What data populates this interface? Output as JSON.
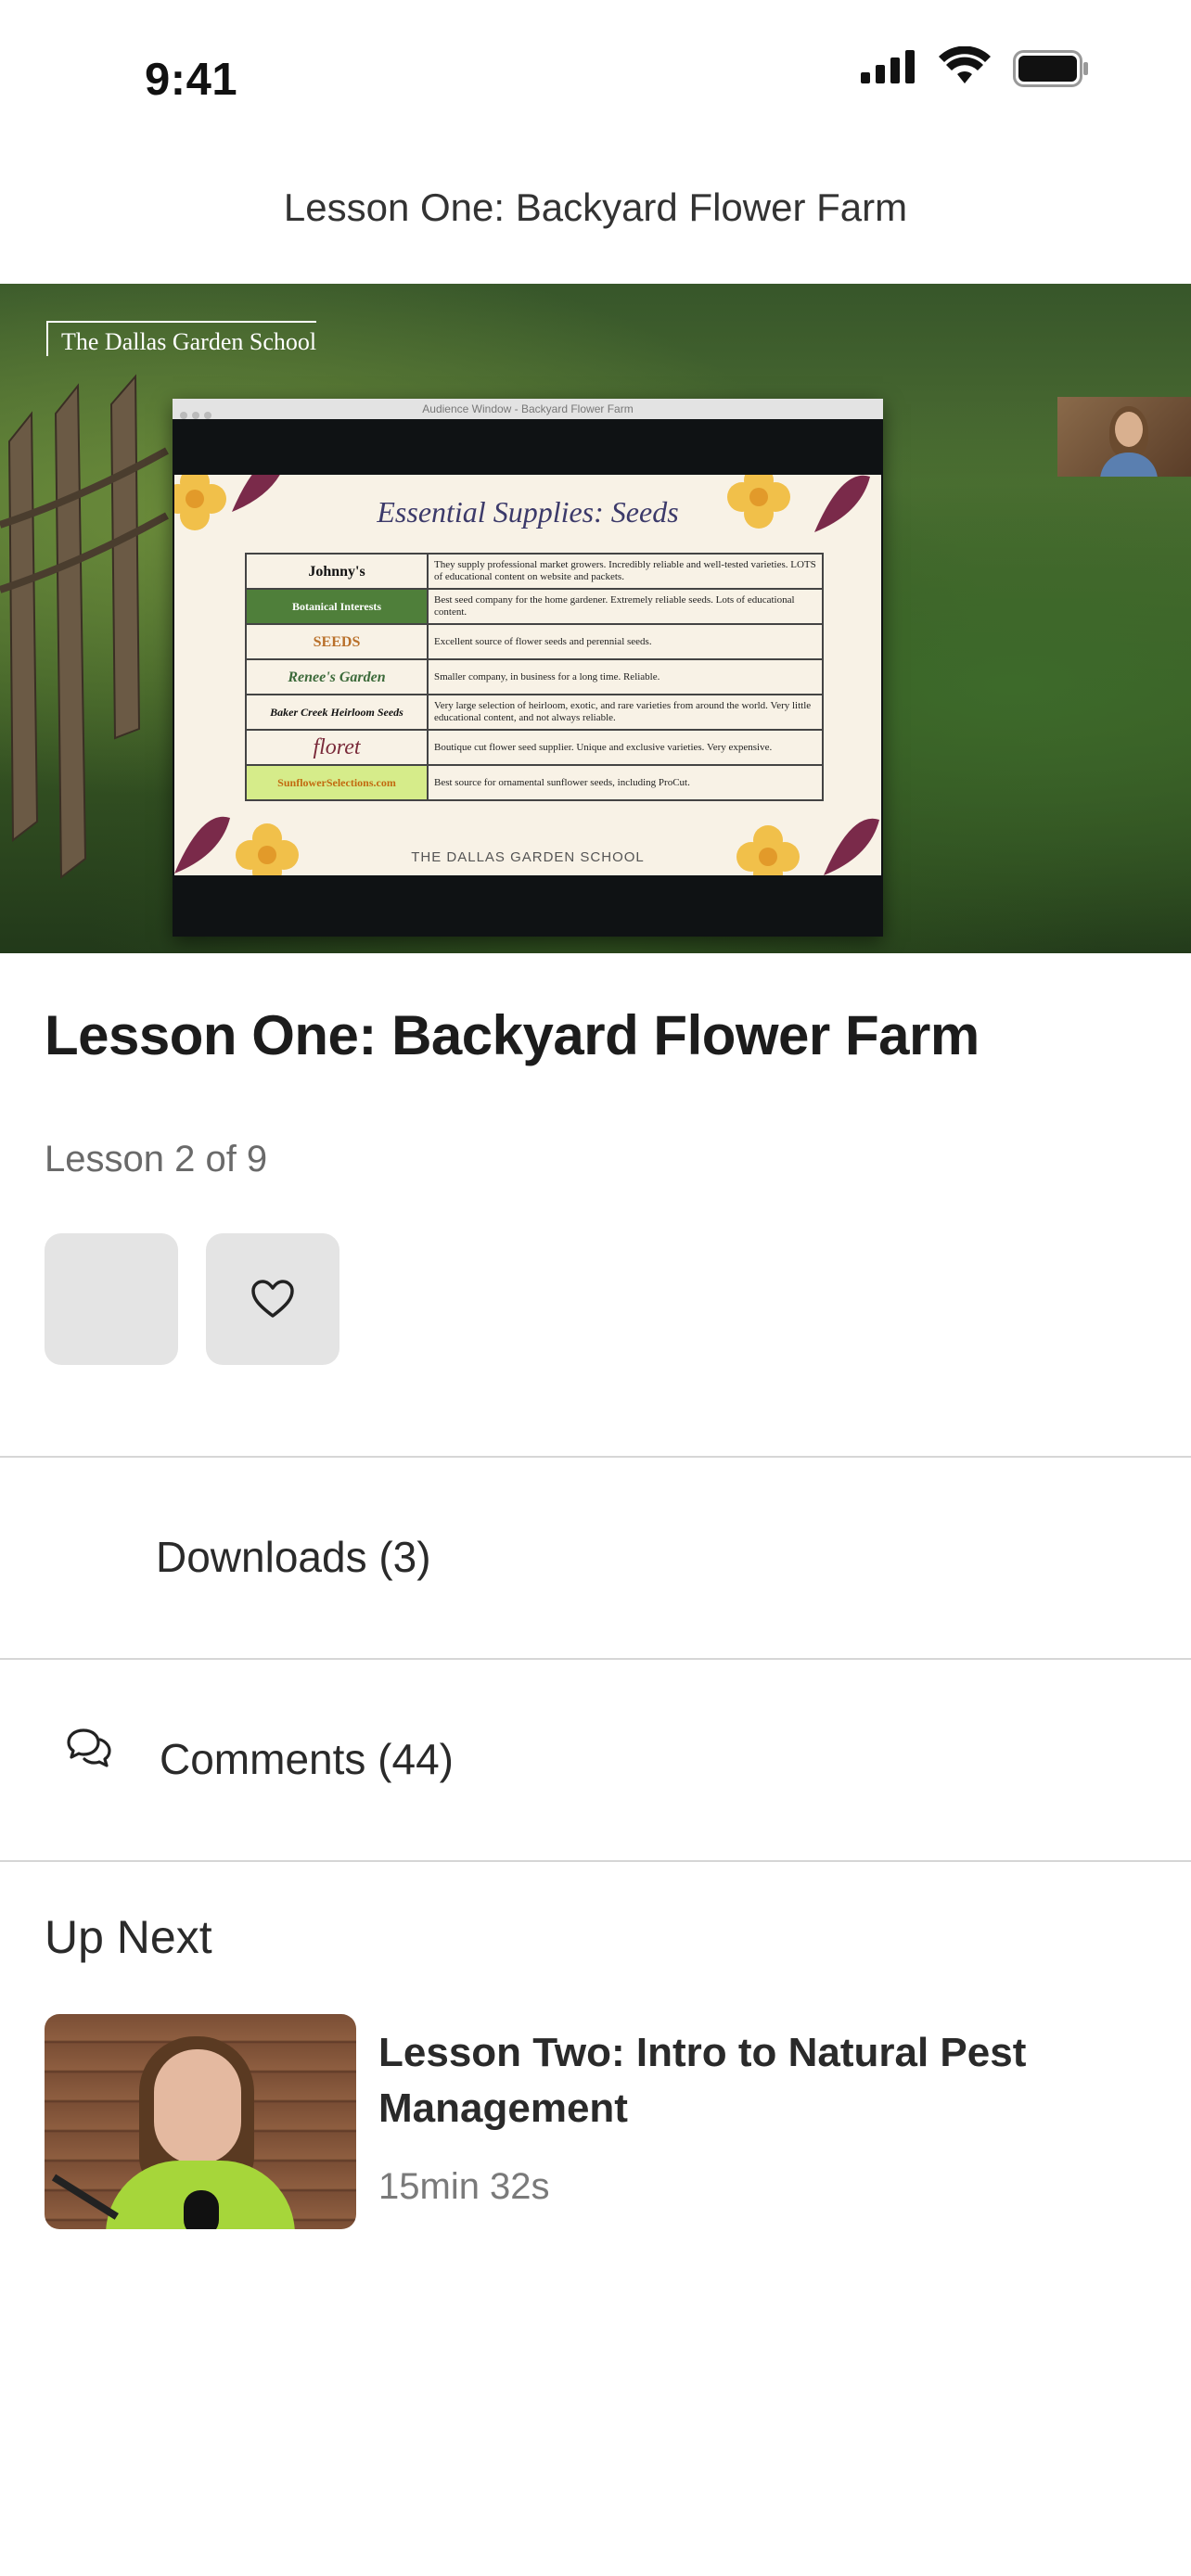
{
  "status_bar": {
    "time": "9:41"
  },
  "nav": {
    "title": "Lesson One: Backyard Flower Farm"
  },
  "video": {
    "watermark": "The Dallas Garden School",
    "window_title": "Audience Window - Backyard Flower Farm",
    "slide": {
      "title": "Essential Supplies: Seeds",
      "rows": [
        {
          "brand": "Johnny's",
          "desc": "They supply professional market growers. Incredibly reliable and well-tested varieties. LOTS of educational content on website and packets."
        },
        {
          "brand": "Botanical Interests",
          "desc": "Best seed company for the home gardener. Extremely reliable seeds. Lots of educational content."
        },
        {
          "brand": "SEEDS",
          "desc": "Excellent source of flower seeds and perennial seeds."
        },
        {
          "brand": "Renee's Garden",
          "desc": "Smaller company, in business for a long time. Reliable."
        },
        {
          "brand": "Baker Creek Heirloom Seeds",
          "desc": "Very large selection of heirloom, exotic, and rare varieties from around the world. Very little educational content, and not always reliable."
        },
        {
          "brand": "floret",
          "desc": "Boutique cut flower seed supplier. Unique and exclusive varieties. Very expensive."
        },
        {
          "brand": "SunflowerSelections.com",
          "desc": "Best source for ornamental sunflower seeds, including ProCut."
        }
      ],
      "footer": "THE DALLAS GARDEN SCHOOL"
    }
  },
  "lesson": {
    "title": "Lesson One: Backyard Flower Farm",
    "progress": "Lesson 2 of 9"
  },
  "sections": {
    "downloads": "Downloads (3)",
    "comments": "Comments (44)"
  },
  "up_next": {
    "heading": "Up Next",
    "title": "Lesson Two: Intro to Natural Pest Management",
    "duration": "15min 32s"
  },
  "icons": {
    "signal": "cellular-signal-icon",
    "wifi": "wifi-icon",
    "battery": "battery-icon",
    "favorite": "heart-icon",
    "download": "download-icon",
    "comments": "comments-icon"
  }
}
